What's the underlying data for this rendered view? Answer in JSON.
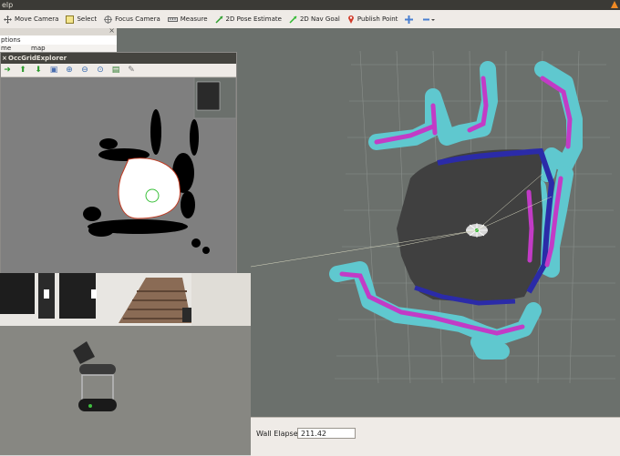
{
  "menubar": {
    "help": "elp"
  },
  "toolbar": {
    "items": [
      {
        "label": "Move Camera",
        "icon": "move-camera-icon"
      },
      {
        "label": "Select",
        "icon": "select-icon"
      },
      {
        "label": "Focus Camera",
        "icon": "focus-camera-icon"
      },
      {
        "label": "Measure",
        "icon": "measure-icon"
      },
      {
        "label": "2D Pose Estimate",
        "icon": "pose-estimate-icon"
      },
      {
        "label": "2D Nav Goal",
        "icon": "nav-goal-icon"
      },
      {
        "label": "Publish Point",
        "icon": "publish-point-icon"
      }
    ]
  },
  "displays": {
    "title": "ptions",
    "row1_key": "me",
    "row1_value": "map"
  },
  "occ": {
    "title": "OccGridExplorer"
  },
  "status": {
    "wall_label": "Wall Elapsed:",
    "wall_value": "211.42"
  },
  "colors": {
    "grid_bg": "#6b706c",
    "cyan": "#5fc8cf",
    "magenta": "#c23bc6",
    "free_dark": "#404040",
    "blue_edge": "#2b2ba8"
  }
}
